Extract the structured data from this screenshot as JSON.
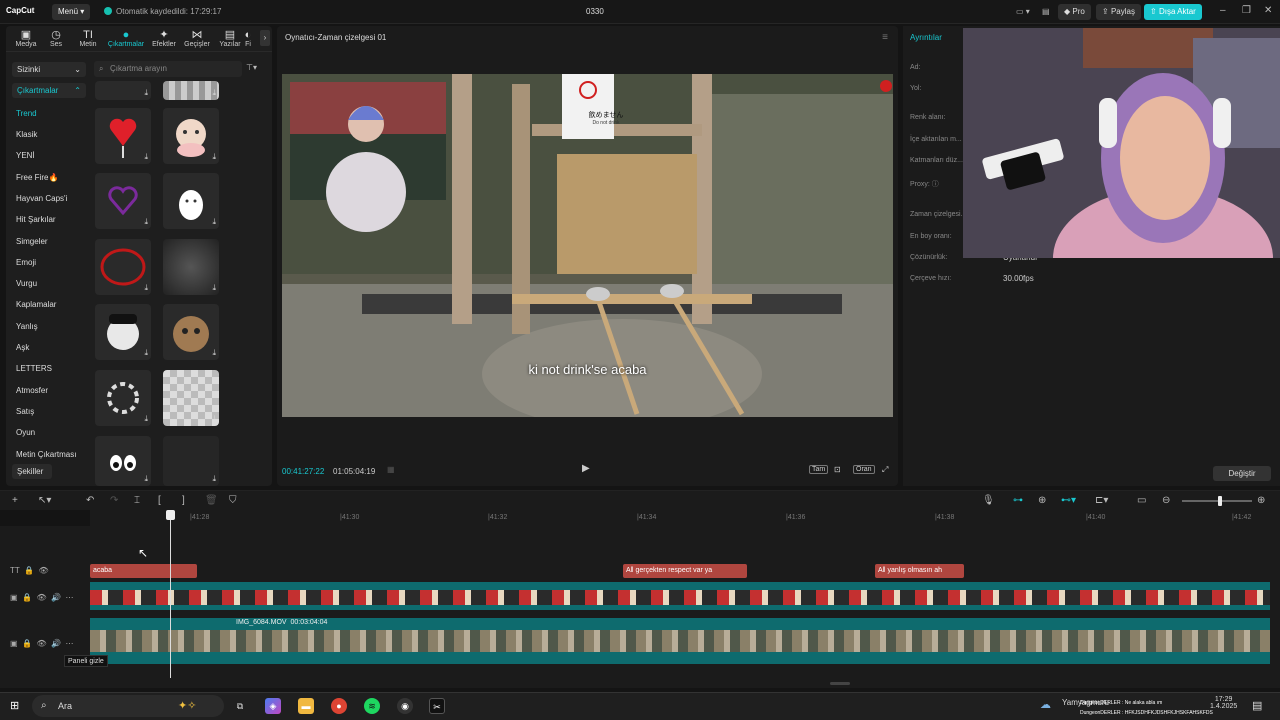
{
  "titlebar": {
    "logo": "CapCut",
    "menu_label": "Menü",
    "autosave_text": "Otomatik kaydedildi: 17:29:17",
    "project_name": "0330",
    "pro_label": "Pro",
    "share_label": "Paylaş",
    "export_label": "Dışa Aktar"
  },
  "tabs": [
    {
      "label": "Medya",
      "icon": "media-icon"
    },
    {
      "label": "Ses",
      "icon": "audio-icon"
    },
    {
      "label": "Metin",
      "icon": "text-icon"
    },
    {
      "label": "Çıkartmalar",
      "icon": "sticker-icon"
    },
    {
      "label": "Efektler",
      "icon": "effects-icon"
    },
    {
      "label": "Geçişler",
      "icon": "transitions-icon"
    },
    {
      "label": "Yazılar",
      "icon": "captions-icon"
    },
    {
      "label": "Fi",
      "icon": "filters-icon"
    }
  ],
  "library": {
    "scope_select": "Sizinki",
    "active_group": "Çıkartmalar",
    "search_placeholder": "Çıkartma arayın",
    "categories": [
      "Trend",
      "Klasik",
      "YENİ",
      "Free Fire🔥",
      "Hayvan Caps'i",
      "Hit Şarkılar",
      "Simgeler",
      "Emoji",
      "Vurgu",
      "Kaplamalar",
      "Yanlış",
      "Aşk",
      "LETTERS",
      "Atmosfer",
      "Satış",
      "Oyun",
      "Metin Çıkartması",
      "Şekiller"
    ]
  },
  "player": {
    "title": "Oynatıcı-Zaman çizelgesi 01",
    "subtitle": "ki not drink'se acaba",
    "sign_text": "飲めません",
    "sign_sub": "Do not drink",
    "current_time": "00:41:27:22",
    "total_time": "01:05:04:19",
    "full_label": "Tam",
    "ratio_label": "Oran"
  },
  "details": {
    "title": "Ayrıntılar",
    "fields": [
      {
        "label": "Ad:",
        "value": ""
      },
      {
        "label": "Yol:",
        "value": ""
      },
      {
        "label": "Renk alanı:",
        "value": ""
      },
      {
        "label": "İçe aktarılan m...",
        "value": ""
      },
      {
        "label": "Katmanları düz...",
        "value": ""
      },
      {
        "label": "Proxy: ⓘ",
        "value": ""
      },
      {
        "label": "Zaman çizelgesi...",
        "value": ""
      },
      {
        "label": "En boy oranı:",
        "value": ""
      },
      {
        "label": "Çözünürlük:",
        "value": "Uyarlandı"
      },
      {
        "label": "Çerçeve hızı:",
        "value": "30.00fps"
      }
    ],
    "change_label": "Değiştir"
  },
  "timeline": {
    "ruler": [
      "|41:28",
      "|41:30",
      "|41:32",
      "|41:34",
      "|41:36",
      "|41:38",
      "|41:40",
      "|41:42"
    ],
    "text_clips": [
      "acaba",
      "gerçekten respect var ya",
      "yanlış olmasın ah"
    ],
    "clip_name": "IMG_6084.MOV",
    "clip_duration": "00:03:04:04",
    "tooltip": "Paneli gizle"
  },
  "taskbar": {
    "search_label": "Ara",
    "notif_1": "DungeonDERLER : Ne alaka abla ım",
    "notif_2": "DungeonDERLER : HFKJSDHFKJDSHFKJHSKFAHSKFDS",
    "username": "Yamyagmuru",
    "time": "17:29",
    "date": "1.4.2025"
  },
  "colors": {
    "accent": "#19c8d0",
    "text_clip": "#b0463f",
    "video_track": "#0e6b6e"
  }
}
